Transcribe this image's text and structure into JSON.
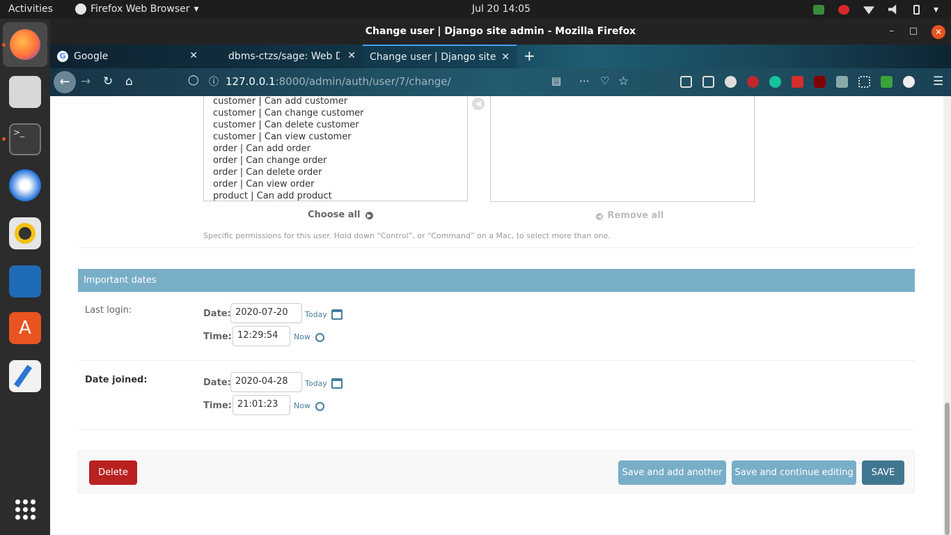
{
  "topbar": {
    "activities": "Activities",
    "app_name": "Firefox Web Browser",
    "clock": "Jul 20  14:05"
  },
  "window": {
    "title": "Change user | Django site admin - Mozilla Firefox"
  },
  "tabs": [
    {
      "label": "Google"
    },
    {
      "label": "dbms-ctzs/sage: Web De"
    },
    {
      "label": "Change user | Django site ad"
    }
  ],
  "url": {
    "host": "127.0.0.1",
    "rest": ":8000/admin/auth/user/7/change/"
  },
  "permissions": {
    "available": [
      "customer | Can add customer",
      "customer | Can change customer",
      "customer | Can delete customer",
      "customer | Can view customer",
      "order | Can add order",
      "order | Can change order",
      "order | Can delete order",
      "order | Can view order",
      "product | Can add product"
    ],
    "choose_all": "Choose all",
    "remove_all": "Remove all",
    "help": "Specific permissions for this user. Hold down “Control”, or “Command” on a Mac, to select more than one."
  },
  "important_dates": {
    "heading": "Important dates",
    "last_login": {
      "label": "Last login:",
      "date_label": "Date:",
      "date": "2020-07-20",
      "today": "Today",
      "time_label": "Time:",
      "time": "12:29:54",
      "now": "Now"
    },
    "date_joined": {
      "label": "Date joined:",
      "date_label": "Date:",
      "date": "2020-04-28",
      "today": "Today",
      "time_label": "Time:",
      "time": "21:01:23",
      "now": "Now"
    }
  },
  "actions": {
    "delete": "Delete",
    "save_add": "Save and add another",
    "save_continue": "Save and continue editing",
    "save": "SAVE"
  },
  "colors": {
    "module_header": "#79aec8",
    "delete_button": "#ba2121",
    "save_button": "#417690",
    "link": "#447e9b",
    "ubuntu_accent": "#e95420"
  }
}
